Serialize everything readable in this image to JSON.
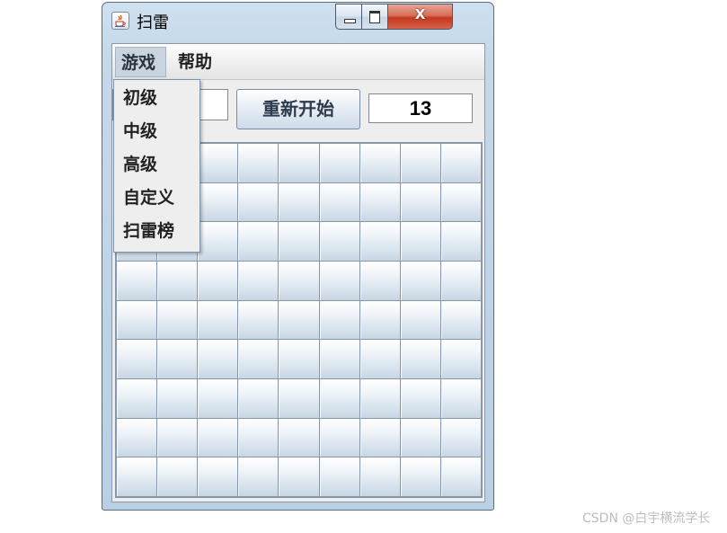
{
  "window": {
    "title": "扫雷",
    "icon": "java-cup-icon",
    "controls": {
      "minimize": "minimize-icon",
      "maximize": "maximize-icon",
      "close_label": "X"
    }
  },
  "menubar": {
    "menus": [
      {
        "label": "游戏",
        "open": true
      },
      {
        "label": "帮助",
        "open": false
      }
    ]
  },
  "game_menu": {
    "items": [
      {
        "label": "初级"
      },
      {
        "label": "中级"
      },
      {
        "label": "高级"
      },
      {
        "label": "自定义"
      },
      {
        "label": "扫雷榜"
      }
    ]
  },
  "toolbar": {
    "mine_count": "",
    "restart_label": "重新开始",
    "timer": "13"
  },
  "board": {
    "rows": 9,
    "cols": 9,
    "state": "unrevealed"
  },
  "watermark": "CSDN @白宇横流学长",
  "colors": {
    "frame": "#c6d9ea",
    "close_button": "#c4391f",
    "menu_selected": "#c9d4df"
  }
}
